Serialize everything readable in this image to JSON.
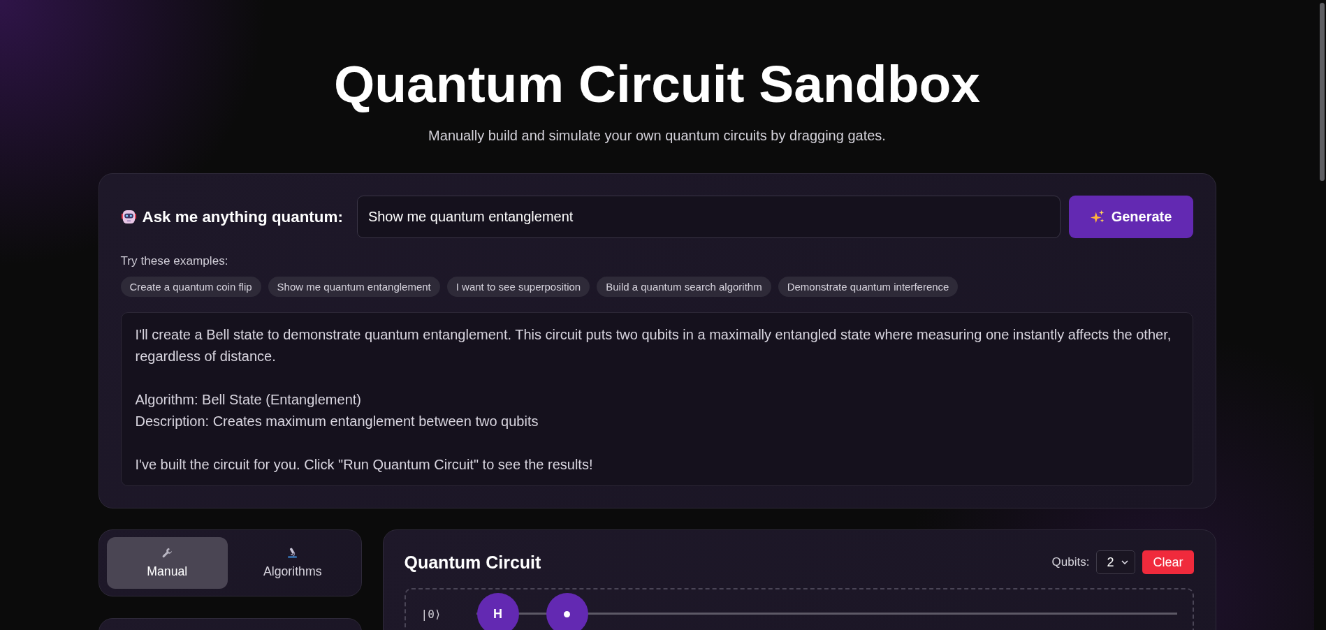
{
  "header": {
    "title": "Quantum Circuit Sandbox",
    "subtitle": "Manually build and simulate your own quantum circuits by dragging gates."
  },
  "assistant": {
    "label": "Ask me anything quantum:",
    "prompt_value": "Show me quantum entanglement",
    "generate_button": "Generate",
    "examples_label": "Try these examples:",
    "examples": [
      "Create a quantum coin flip",
      "Show me quantum entanglement",
      "I want to see superposition",
      "Build a quantum search algorithm",
      "Demonstrate quantum interference"
    ],
    "response": [
      [
        "I'll create a Bell state to demonstrate quantum entanglement. This circuit puts two qubits in a maximally entangled state where measuring one instantly affects the other, regardless of distance."
      ],
      [
        "Algorithm: Bell State (Entanglement)",
        "Description: Creates maximum entanglement between two qubits"
      ],
      [
        "I've built the circuit for you. Click \"Run Quantum Circuit\" to see the results!"
      ]
    ]
  },
  "modes": [
    {
      "kind": "manual",
      "label": "Manual",
      "selected": true
    },
    {
      "kind": "algorithms",
      "label": "Algorithms",
      "selected": false
    }
  ],
  "circuit": {
    "title": "Quantum Circuit",
    "qubits_label": "Qubits:",
    "qubits_value": "2",
    "clear_button": "Clear",
    "wires": [
      {
        "label": "|0⟩",
        "gates": [
          {
            "kind": "gate",
            "symbol": "H"
          },
          {
            "kind": "control"
          }
        ]
      }
    ]
  }
}
